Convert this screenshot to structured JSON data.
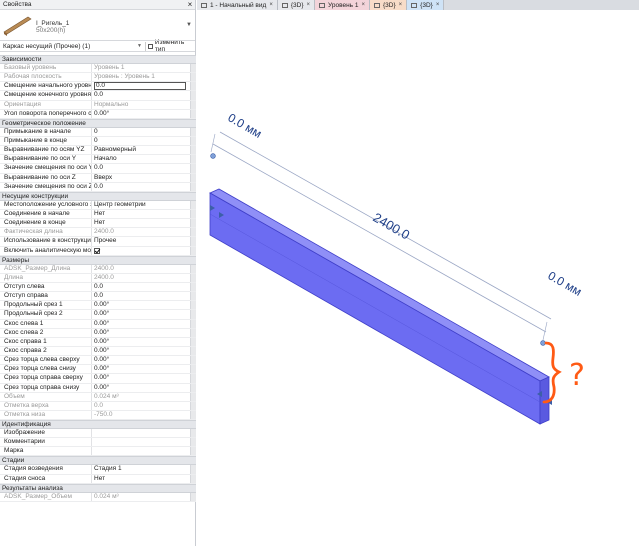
{
  "panel": {
    "title": "Свойства",
    "type_name": "I_Ригель_1",
    "type_size": "50x200(h)",
    "selector": "Каркас несущий (Прочее) (1)",
    "edit_type": "Изменить тип"
  },
  "groups": [
    {
      "title": "Зависимости",
      "rows": [
        {
          "label": "Базовый уровень",
          "value": "Уровень 1",
          "disabled": true
        },
        {
          "label": "Рабочая плоскость",
          "value": "Уровень : Уровень 1",
          "disabled": true
        },
        {
          "label": "Смещение начального уровня",
          "value": "0.0",
          "editing": true
        },
        {
          "label": "Смещение конечного уровня",
          "value": "0.0"
        },
        {
          "label": "Ориентация",
          "value": "Нормально",
          "disabled": true
        },
        {
          "label": "Угол поворота поперечного се...",
          "value": "0.00°"
        }
      ]
    },
    {
      "title": "Геометрическое положение",
      "rows": [
        {
          "label": "Примыкание в начале",
          "value": "0"
        },
        {
          "label": "Примыкание в конце",
          "value": "0"
        },
        {
          "label": "Выравнивание по осям YZ",
          "value": "Равномерный"
        },
        {
          "label": "Выравнивание по оси Y",
          "value": "Начало"
        },
        {
          "label": "Значение смещения по оси Y",
          "value": "0.0"
        },
        {
          "label": "Выравнивание по оси Z",
          "value": "Вверх"
        },
        {
          "label": "Значение смещения по оси Z",
          "value": "0.0"
        }
      ]
    },
    {
      "title": "Несущие конструкции",
      "rows": [
        {
          "label": "Местоположение условного зна...",
          "value": "Центр геометрии"
        },
        {
          "label": "Соединение в начале",
          "value": "Нет"
        },
        {
          "label": "Соединение в конце",
          "value": "Нет"
        },
        {
          "label": "Фактическая длина",
          "value": "2400.0",
          "disabled": true
        },
        {
          "label": "Использование в конструкции",
          "value": "Прочее"
        },
        {
          "label": "Включить аналитическую модель",
          "value": "",
          "checkbox": true
        }
      ]
    },
    {
      "title": "Размеры",
      "rows": [
        {
          "label": "ADSK_Размер_Длина",
          "value": "2400.0",
          "disabled": true
        },
        {
          "label": "Длина",
          "value": "2400.0",
          "disabled": true
        },
        {
          "label": "Отступ слева",
          "value": "0.0"
        },
        {
          "label": "Отступ справа",
          "value": "0.0"
        },
        {
          "label": "Продольный срез 1",
          "value": "0.00°"
        },
        {
          "label": "Продольный срез 2",
          "value": "0.00°"
        },
        {
          "label": "Скос слева 1",
          "value": "0.00°"
        },
        {
          "label": "Скос слева 2",
          "value": "0.00°"
        },
        {
          "label": "Скос справа 1",
          "value": "0.00°"
        },
        {
          "label": "Скос справа 2",
          "value": "0.00°"
        },
        {
          "label": "Срез торца слева сверху",
          "value": "0.00°"
        },
        {
          "label": "Срез торца слева снизу",
          "value": "0.00°"
        },
        {
          "label": "Срез торца справа сверху",
          "value": "0.00°"
        },
        {
          "label": "Срез торца справа снизу",
          "value": "0.00°"
        },
        {
          "label": "Объем",
          "value": "0.024 м³",
          "disabled": true
        },
        {
          "label": "Отметка верха",
          "value": "0.0",
          "disabled": true
        },
        {
          "label": "Отметка низа",
          "value": "-750.0",
          "disabled": true
        }
      ]
    },
    {
      "title": "Идентификация",
      "rows": [
        {
          "label": "Изображение",
          "value": ""
        },
        {
          "label": "Комментарии",
          "value": ""
        },
        {
          "label": "Марка",
          "value": ""
        }
      ]
    },
    {
      "title": "Стадии",
      "rows": [
        {
          "label": "Стадия возведения",
          "value": "Стадия 1"
        },
        {
          "label": "Стадия сноса",
          "value": "Нет"
        }
      ]
    },
    {
      "title": "Результаты анализа",
      "rows": [
        {
          "label": "ADSK_Размер_Объем",
          "value": "0.024 м³",
          "disabled": true
        }
      ]
    }
  ],
  "tabs": [
    {
      "label": "1 - Начальный вид",
      "color": "#e6e8ec"
    },
    {
      "label": "{3D}",
      "color": "#e6e8ec"
    },
    {
      "label": "Уровень 1",
      "color": "#f3d4da"
    },
    {
      "label": "{3D}",
      "color": "#f7dcc8"
    },
    {
      "label": "{3D}",
      "color": "#cfe3f6",
      "active": true
    }
  ],
  "view": {
    "dim_length": "2400.0",
    "dim_offset_start": "0.0 мм",
    "dim_offset_end": "0.0 мм",
    "question_mark": "?",
    "beam_color": "#6c6cf2",
    "annotation_color": "#ff5a14"
  }
}
